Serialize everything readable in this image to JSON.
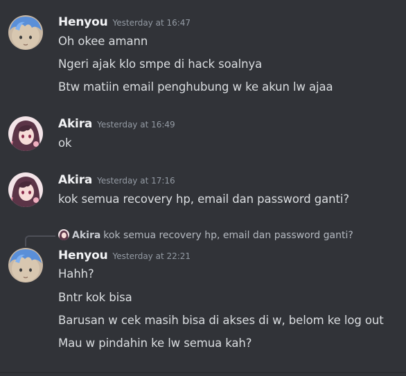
{
  "messages": [
    {
      "author": "Henyou",
      "timestamp": "Yesterday at 16:47",
      "lines": [
        "Oh okee amann",
        "Ngeri ajak klo smpe di hack soalnya",
        "Btw matiin email penghubung w ke akun lw ajaa"
      ]
    },
    {
      "author": "Akira",
      "timestamp": "Yesterday at 16:49",
      "lines": [
        "ok"
      ]
    },
    {
      "author": "Akira",
      "timestamp": "Yesterday at 17:16",
      "lines": [
        "kok semua recovery hp, email dan password ganti?"
      ]
    },
    {
      "reply": {
        "author": "Akira",
        "text": "kok semua recovery hp, email dan password ganti?"
      },
      "author": "Henyou",
      "timestamp": "Yesterday at 22:21",
      "lines": [
        "Hahh?",
        "Bntr kok bisa",
        "Barusan w cek masih bisa di akses di w, belom ke log out",
        "Mau w pindahin ke lw semua kah?"
      ]
    }
  ],
  "colors": {
    "background": "#313338",
    "author": "#f2f3f5",
    "timestamp": "#949ba4",
    "text": "#dbdee1"
  }
}
